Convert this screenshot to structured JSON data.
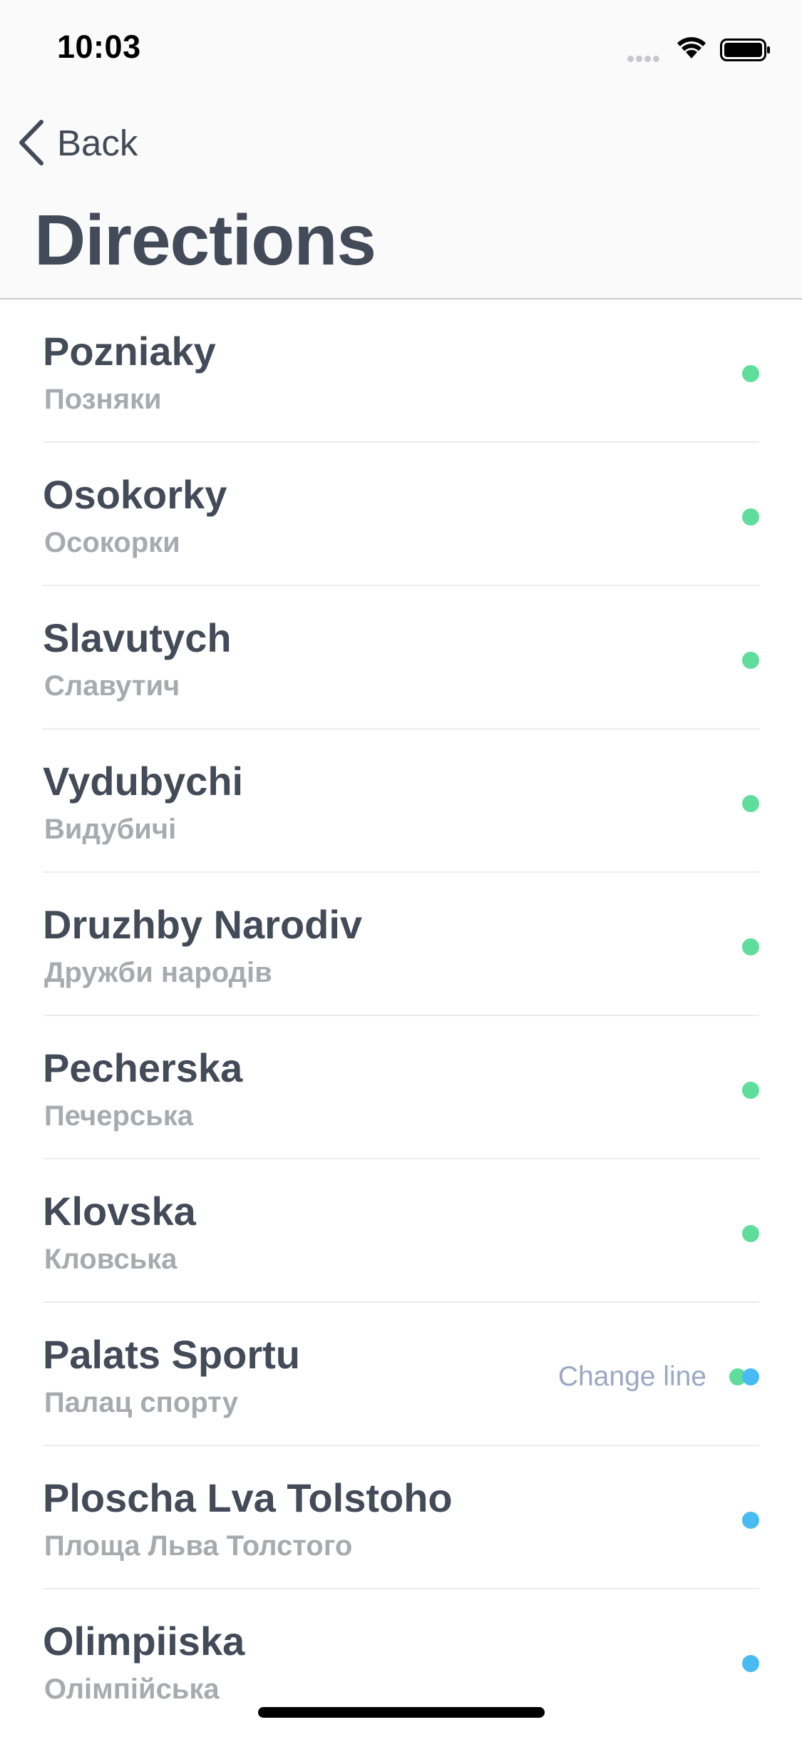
{
  "status_bar": {
    "time": "10:03"
  },
  "header": {
    "back_label": "Back",
    "title": "Directions"
  },
  "colors": {
    "line_green": "#5fdd9b",
    "line_blue": "#48bcf2",
    "text_primary": "#434a58",
    "text_secondary": "#a8aab0",
    "change_line": "#9aa8c2"
  },
  "stations": [
    {
      "name": "Pozniaky",
      "native": "Позняки",
      "lines": [
        "green"
      ],
      "action": ""
    },
    {
      "name": "Osokorky",
      "native": "Осокорки",
      "lines": [
        "green"
      ],
      "action": ""
    },
    {
      "name": "Slavutych",
      "native": "Славутич",
      "lines": [
        "green"
      ],
      "action": ""
    },
    {
      "name": "Vydubychi",
      "native": "Видубичі",
      "lines": [
        "green"
      ],
      "action": ""
    },
    {
      "name": "Druzhby Narodiv",
      "native": "Дружби народів",
      "lines": [
        "green"
      ],
      "action": ""
    },
    {
      "name": "Pecherska",
      "native": "Печерська",
      "lines": [
        "green"
      ],
      "action": ""
    },
    {
      "name": "Klovska",
      "native": "Кловська",
      "lines": [
        "green"
      ],
      "action": ""
    },
    {
      "name": "Palats Sportu",
      "native": "Палац спорту",
      "lines": [
        "green",
        "blue"
      ],
      "action": "Change line"
    },
    {
      "name": "Ploscha Lva Tolstoho",
      "native": "Площа Льва Толстого",
      "lines": [
        "blue"
      ],
      "action": ""
    },
    {
      "name": "Olimpiiska",
      "native": "Олімпійська",
      "lines": [
        "blue"
      ],
      "action": ""
    }
  ]
}
